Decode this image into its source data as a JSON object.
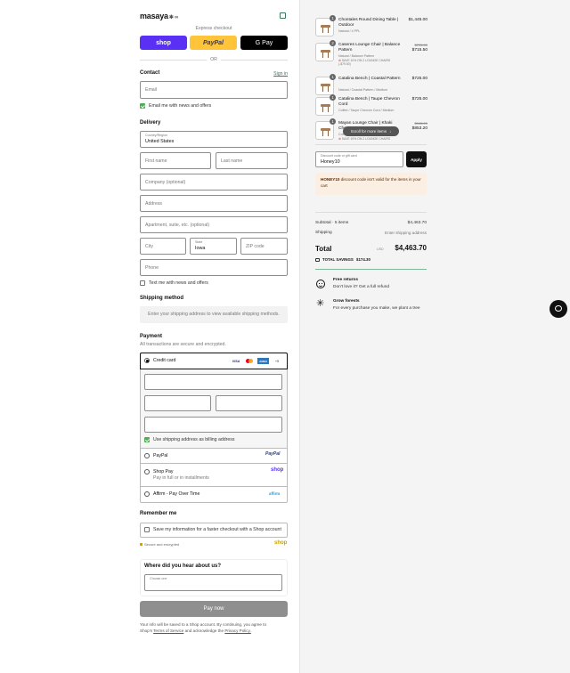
{
  "brand": {
    "logo_text": "masaya",
    "accent": "#3a7a5a"
  },
  "express": {
    "label": "Express checkout",
    "shop_label": "shop",
    "paypal_label": "PayPal",
    "gpay_label": "G Pay",
    "or_label": "OR"
  },
  "contact": {
    "title": "Contact",
    "sign_in": "Sign in",
    "email_placeholder": "Email",
    "news_label": "Email me with news and offers"
  },
  "delivery": {
    "title": "Delivery",
    "country_label": "Country/Region",
    "country_value": "United States",
    "first_name": "First name",
    "last_name": "Last name",
    "company": "Company (optional)",
    "address": "Address",
    "apartment": "Apartment, suite, etc. (optional)",
    "city": "City",
    "state_label": "State",
    "state_value": "Iowa",
    "zip": "ZIP code",
    "phone": "Phone",
    "text_label": "Text me with news and offers"
  },
  "shipping": {
    "title": "Shipping method",
    "notice": "Enter your shipping address to view available shipping methods."
  },
  "payment": {
    "title": "Payment",
    "subtitle": "All transactions are secure and encrypted.",
    "credit_card": "Credit card",
    "card_brands": [
      "VISA",
      "MC",
      "AMEX",
      "+5"
    ],
    "billing_label": "Use shipping address as billing address",
    "paypal": "PayPal",
    "paypal_logo": "PayPal",
    "shop_pay": "Shop Pay",
    "shop_pay_sub": "Pay in full or in installments",
    "shop_pay_logo": "shop",
    "affirm": "Affirm - Pay Over Time",
    "affirm_logo": "affirm"
  },
  "remember": {
    "title": "Remember me",
    "save_label": "Save my information for a faster checkout with a Shop account",
    "secure": "Secure and encrypted",
    "shop_logo": "shop"
  },
  "survey": {
    "title": "Where did you hear about us?",
    "select_label": "Choose one"
  },
  "pay_button": "Pay now",
  "footer": {
    "line1": "Your info will be saved to a Shop account. By continuing, you agree to",
    "line2_pre": "Shop's",
    "terms": "Terms of Service",
    "line2_mid": "and acknowledge the",
    "privacy": "Privacy Policy."
  },
  "cart": {
    "items": [
      {
        "qty": "1",
        "name": "Chontales Round Dining Table | Outdoor",
        "variant": "Natural / 4 PPL",
        "price": "$1,445.00",
        "old_price": "",
        "promo": ""
      },
      {
        "qty": "2",
        "name": "Caseres Lounge Chair | Balance Pattern",
        "variant": "Natural / Balance Pattern",
        "price": "$715.50",
        "old_price": "$795.00",
        "promo": "SAVE 10% ON 2 LOUNGE CHAIRS (-$79.50)"
      },
      {
        "qty": "1",
        "name": "Catalina Bench | Coastal Pattern",
        "variant": "Natural / Coastal Pattern / Medium",
        "price": "$725.00",
        "old_price": "",
        "promo": ""
      },
      {
        "qty": "1",
        "name": "Catalina Bench | Taupe Chevron Cord",
        "variant": "Coffee / Taupe Chevron Cord / Medium",
        "price": "$725.00",
        "old_price": "",
        "promo": ""
      },
      {
        "qty": "1",
        "name": "Mayan Lounge Chair | Khaki Chevron",
        "variant": "Coffee / Khaki Chevron",
        "price": "$853.20",
        "old_price": "$948.00",
        "promo": "SAVE 10% ON 2 LOUNGE CHAIRS"
      }
    ],
    "scroll_hint": "Scroll for more items",
    "discount_label": "Discount code or gift card",
    "discount_value": "Honey10",
    "apply": "Apply",
    "error_code": "HONEY10",
    "error_text": "discount code isn't valid for the items in your cart",
    "subtotal_label": "Subtotal · 5 items",
    "subtotal_value": "$4,463.70",
    "shipping_label": "Shipping",
    "shipping_value": "Enter shipping address",
    "total_label": "Total",
    "currency": "USD",
    "total_value": "$4,463.70",
    "savings_label": "TOTAL SAVINGS",
    "savings_value": "$174.30"
  },
  "perks": [
    {
      "title": "Free returns",
      "text": "Don't love it? Get a full refund"
    },
    {
      "title": "Grow forests",
      "text": "For every purchase you make, we plant a tree"
    }
  ]
}
